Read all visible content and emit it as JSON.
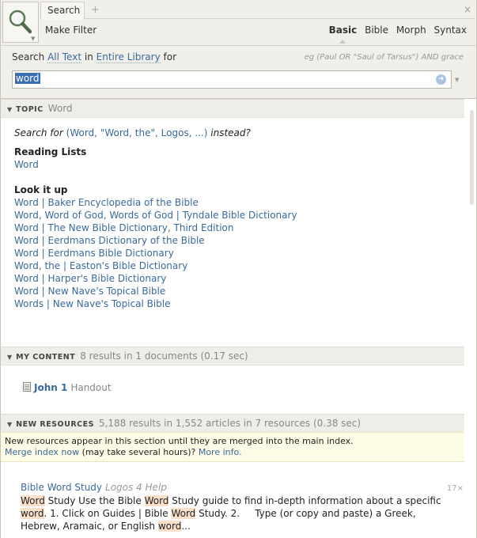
{
  "toolbar": {
    "tab_label": "Search",
    "tab_add": "+",
    "tab_close": "×",
    "make_filter": "Make Filter",
    "modes": [
      "Basic",
      "Bible",
      "Morph",
      "Syntax"
    ],
    "active_mode": "Basic"
  },
  "search": {
    "prefix": "Search",
    "field": "All Text",
    "in": "in",
    "scope": "Entire Library",
    "for": "for",
    "example": "eg (Paul OR \"Saul of Tarsus\") AND grace",
    "query": "word"
  },
  "topic": {
    "header": "TOPIC",
    "info": "Word",
    "suggest_pre": "Search for",
    "suggest_link": "(Word, \"Word, the\", Logos, ...)",
    "suggest_post": "instead?",
    "reading_lists_label": "Reading Lists",
    "reading_lists": [
      "Word"
    ],
    "look_it_up_label": "Look it up",
    "look_it_up": [
      "Word | Baker Encyclopedia of the Bible",
      "Word, Word of God, Words of God | Tyndale Bible Dictionary",
      "Word | The New Bible Dictionary, Third Edition",
      "Word | Eerdmans Dictionary of the Bible",
      "Word | Eerdmans Bible Dictionary",
      "Word, the | Easton's Bible Dictionary",
      "Word | Harper's Bible Dictionary",
      "Word | New Nave's Topical Bible",
      "Words | New Nave's Topical Bible"
    ]
  },
  "my_content": {
    "header": "MY CONTENT",
    "info": "8 results in 1 documents (0.17 sec)",
    "item_title": "John 1",
    "item_type": "Handout"
  },
  "new_resources": {
    "header": "NEW RESOURCES",
    "info": "5,188 results in 1,552 articles in 7 resources (0.38 sec)",
    "notice_line1": "New resources appear in this section until they are merged into the main index.",
    "merge_link": "Merge index now",
    "notice_mid": "(may take several hours)?",
    "more_info": "More info.",
    "result_title": "Bible Word Study",
    "result_resource": "Logos 4 Help",
    "result_count": "17×",
    "snippet_parts": [
      "Word",
      " Study Use the Bible ",
      "Word",
      " Study guide to find in-depth information about a specific ",
      "word",
      ". 1. Click on Guides | Bible ",
      "Word",
      " Study. 2.     Type (or copy and paste) a Greek, Hebrew, Aramaic, or English ",
      "word",
      "..."
    ]
  },
  "colors": {
    "accent_link": "#3a6a9a",
    "selection": "#3a6fb0",
    "highlight": "#f9e0c8",
    "notice_bg": "#fdfbe6"
  },
  "icons": [
    "search-icon",
    "dropdown-arrow-icon",
    "go-arrow-icon",
    "collapse-triangle-icon",
    "document-icon"
  ]
}
